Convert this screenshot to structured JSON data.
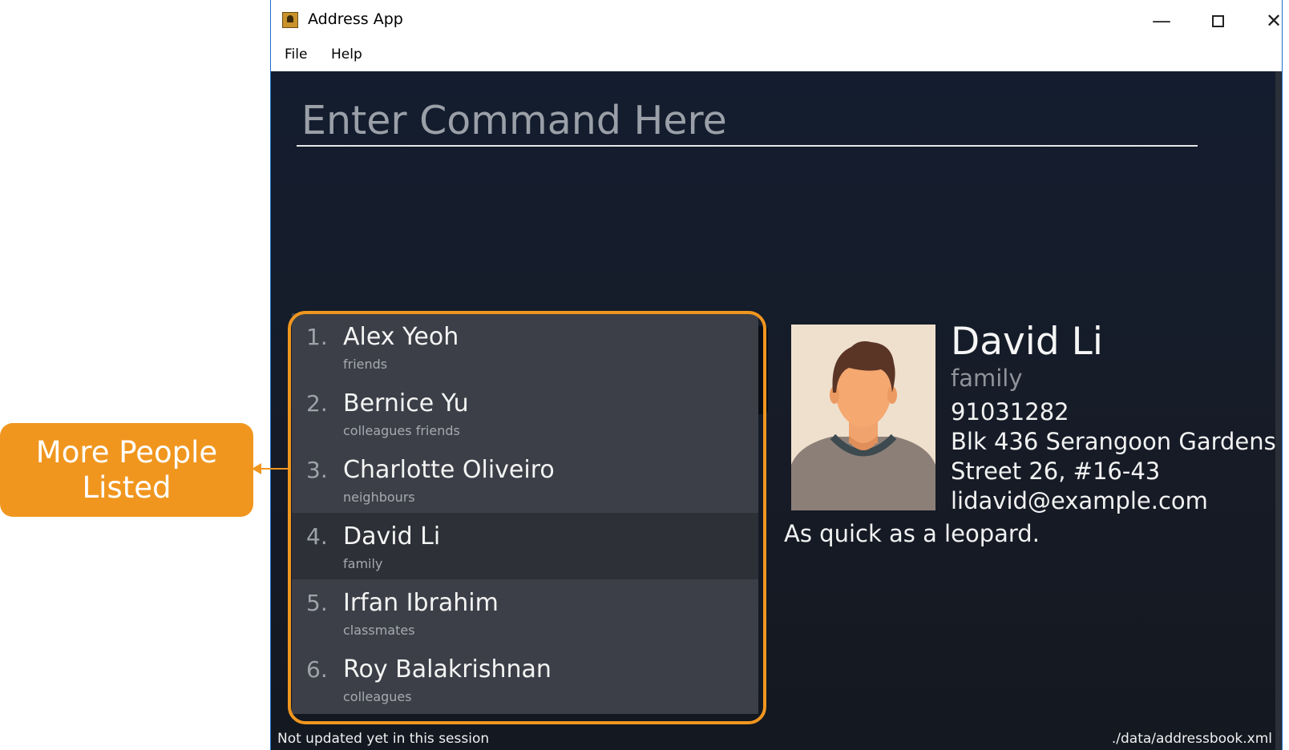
{
  "window": {
    "title": "Address App",
    "minimize_label": "—",
    "maximize_label": "",
    "close_label": "✕"
  },
  "menu": {
    "file": "File",
    "help": "Help"
  },
  "command": {
    "placeholder": "Enter Command Here"
  },
  "persons": [
    {
      "index": "1.",
      "name": "Alex Yeoh",
      "tags": "friends"
    },
    {
      "index": "2.",
      "name": "Bernice Yu",
      "tags": "colleagues  friends"
    },
    {
      "index": "3.",
      "name": "Charlotte Oliveiro",
      "tags": "neighbours"
    },
    {
      "index": "4.",
      "name": "David Li",
      "tags": "family"
    },
    {
      "index": "5.",
      "name": "Irfan Ibrahim",
      "tags": "classmates"
    },
    {
      "index": "6.",
      "name": "Roy Balakrishnan",
      "tags": "colleagues"
    }
  ],
  "selected_index": 4,
  "detail": {
    "name": "David Li",
    "tag": "family",
    "phone": "91031282",
    "address_line1": "Blk 436 Serangoon Gardens",
    "address_line2": "Street 26, #16-43",
    "email": "lidavid@example.com",
    "quote": "As quick as a leopard."
  },
  "status": {
    "sync": "Not updated yet in this session",
    "file_path": "./data/addressbook.xml"
  },
  "annotation": {
    "line1": "More People",
    "line2": "Listed"
  },
  "colors": {
    "accent": "#f0961f",
    "background": "#141d2f",
    "list_bg": "#3c3f47",
    "selected_row": "#2d3036"
  }
}
